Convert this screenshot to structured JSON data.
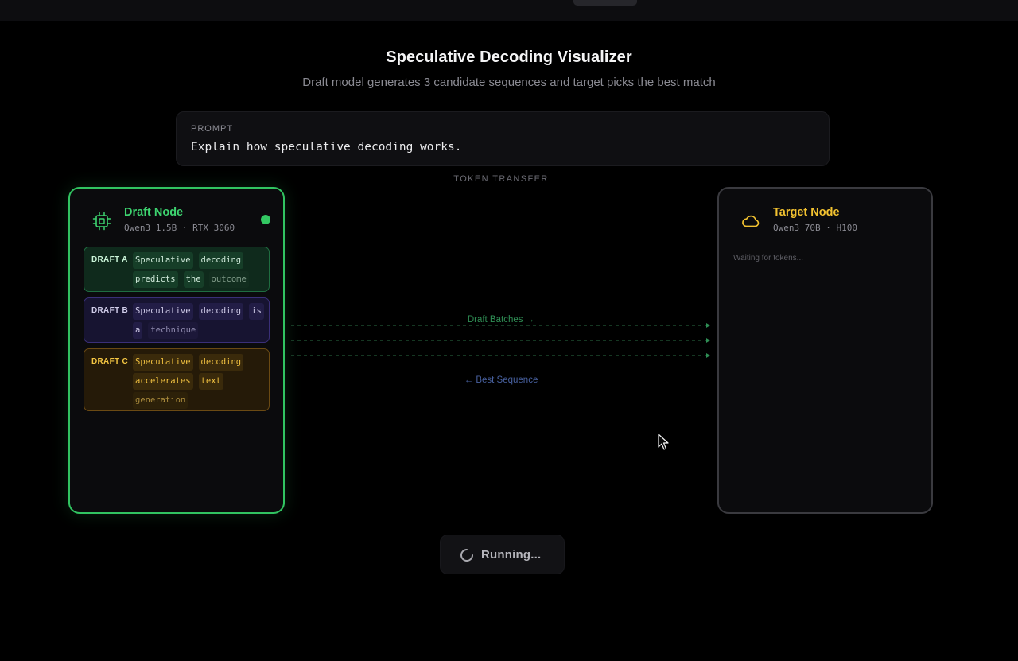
{
  "header": {
    "title": "Speculative Decoding Visualizer",
    "subtitle": "Draft model generates 3 candidate sequences and target picks the best match"
  },
  "prompt": {
    "label": "PROMPT",
    "text": "Explain how speculative decoding works."
  },
  "transfer": {
    "label": "TOKEN TRANSFER",
    "draft_batches_label": "Draft Batches →",
    "best_sequence_label": "← Best Sequence"
  },
  "draft_node": {
    "name": "Draft Node",
    "model": "Qwen3 1.5B · RTX 3060",
    "icon": "cpu-chip-icon",
    "status_color": "#33c862",
    "accent": "#3dd36f",
    "drafts": [
      {
        "label": "DRAFT A",
        "tokens": [
          "Speculative",
          "decoding",
          "predicts",
          "the",
          "outcome"
        ]
      },
      {
        "label": "DRAFT B",
        "tokens": [
          "Speculative",
          "decoding",
          "is",
          "a",
          "technique"
        ]
      },
      {
        "label": "DRAFT C",
        "tokens": [
          "Speculative",
          "decoding",
          "accelerates",
          "text",
          "generation"
        ]
      }
    ]
  },
  "target_node": {
    "name": "Target Node",
    "model": "Qwen3 70B · H100",
    "icon": "cloud-icon",
    "accent": "#f2c230",
    "waiting_text": "Waiting for tokens..."
  },
  "run_button": {
    "label": "Running...",
    "icon": "spinner-icon"
  }
}
